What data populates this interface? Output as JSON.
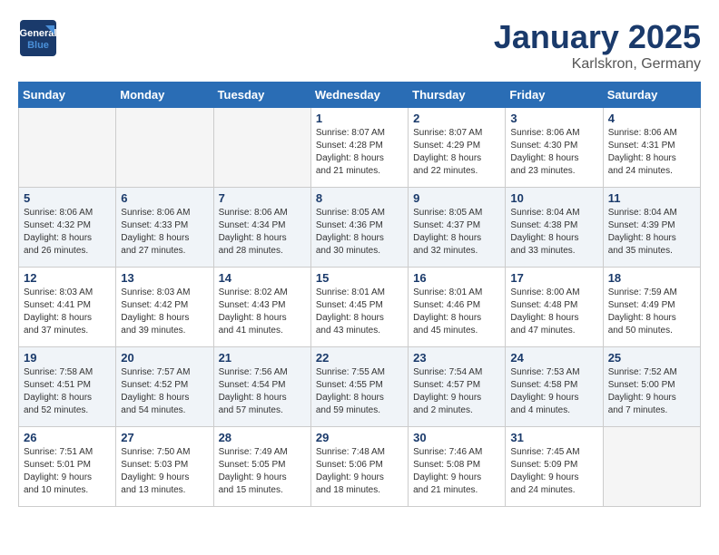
{
  "header": {
    "logo_general": "General",
    "logo_blue": "Blue",
    "title": "January 2025",
    "subtitle": "Karlskron, Germany"
  },
  "days_of_week": [
    "Sunday",
    "Monday",
    "Tuesday",
    "Wednesday",
    "Thursday",
    "Friday",
    "Saturday"
  ],
  "weeks": [
    {
      "days": [
        {
          "number": "",
          "info": "",
          "empty": true
        },
        {
          "number": "",
          "info": "",
          "empty": true
        },
        {
          "number": "",
          "info": "",
          "empty": true
        },
        {
          "number": "1",
          "info": "Sunrise: 8:07 AM\nSunset: 4:28 PM\nDaylight: 8 hours\nand 21 minutes.",
          "empty": false
        },
        {
          "number": "2",
          "info": "Sunrise: 8:07 AM\nSunset: 4:29 PM\nDaylight: 8 hours\nand 22 minutes.",
          "empty": false
        },
        {
          "number": "3",
          "info": "Sunrise: 8:06 AM\nSunset: 4:30 PM\nDaylight: 8 hours\nand 23 minutes.",
          "empty": false
        },
        {
          "number": "4",
          "info": "Sunrise: 8:06 AM\nSunset: 4:31 PM\nDaylight: 8 hours\nand 24 minutes.",
          "empty": false
        }
      ]
    },
    {
      "days": [
        {
          "number": "5",
          "info": "Sunrise: 8:06 AM\nSunset: 4:32 PM\nDaylight: 8 hours\nand 26 minutes.",
          "empty": false
        },
        {
          "number": "6",
          "info": "Sunrise: 8:06 AM\nSunset: 4:33 PM\nDaylight: 8 hours\nand 27 minutes.",
          "empty": false
        },
        {
          "number": "7",
          "info": "Sunrise: 8:06 AM\nSunset: 4:34 PM\nDaylight: 8 hours\nand 28 minutes.",
          "empty": false
        },
        {
          "number": "8",
          "info": "Sunrise: 8:05 AM\nSunset: 4:36 PM\nDaylight: 8 hours\nand 30 minutes.",
          "empty": false
        },
        {
          "number": "9",
          "info": "Sunrise: 8:05 AM\nSunset: 4:37 PM\nDaylight: 8 hours\nand 32 minutes.",
          "empty": false
        },
        {
          "number": "10",
          "info": "Sunrise: 8:04 AM\nSunset: 4:38 PM\nDaylight: 8 hours\nand 33 minutes.",
          "empty": false
        },
        {
          "number": "11",
          "info": "Sunrise: 8:04 AM\nSunset: 4:39 PM\nDaylight: 8 hours\nand 35 minutes.",
          "empty": false
        }
      ]
    },
    {
      "days": [
        {
          "number": "12",
          "info": "Sunrise: 8:03 AM\nSunset: 4:41 PM\nDaylight: 8 hours\nand 37 minutes.",
          "empty": false
        },
        {
          "number": "13",
          "info": "Sunrise: 8:03 AM\nSunset: 4:42 PM\nDaylight: 8 hours\nand 39 minutes.",
          "empty": false
        },
        {
          "number": "14",
          "info": "Sunrise: 8:02 AM\nSunset: 4:43 PM\nDaylight: 8 hours\nand 41 minutes.",
          "empty": false
        },
        {
          "number": "15",
          "info": "Sunrise: 8:01 AM\nSunset: 4:45 PM\nDaylight: 8 hours\nand 43 minutes.",
          "empty": false
        },
        {
          "number": "16",
          "info": "Sunrise: 8:01 AM\nSunset: 4:46 PM\nDaylight: 8 hours\nand 45 minutes.",
          "empty": false
        },
        {
          "number": "17",
          "info": "Sunrise: 8:00 AM\nSunset: 4:48 PM\nDaylight: 8 hours\nand 47 minutes.",
          "empty": false
        },
        {
          "number": "18",
          "info": "Sunrise: 7:59 AM\nSunset: 4:49 PM\nDaylight: 8 hours\nand 50 minutes.",
          "empty": false
        }
      ]
    },
    {
      "days": [
        {
          "number": "19",
          "info": "Sunrise: 7:58 AM\nSunset: 4:51 PM\nDaylight: 8 hours\nand 52 minutes.",
          "empty": false
        },
        {
          "number": "20",
          "info": "Sunrise: 7:57 AM\nSunset: 4:52 PM\nDaylight: 8 hours\nand 54 minutes.",
          "empty": false
        },
        {
          "number": "21",
          "info": "Sunrise: 7:56 AM\nSunset: 4:54 PM\nDaylight: 8 hours\nand 57 minutes.",
          "empty": false
        },
        {
          "number": "22",
          "info": "Sunrise: 7:55 AM\nSunset: 4:55 PM\nDaylight: 8 hours\nand 59 minutes.",
          "empty": false
        },
        {
          "number": "23",
          "info": "Sunrise: 7:54 AM\nSunset: 4:57 PM\nDaylight: 9 hours\nand 2 minutes.",
          "empty": false
        },
        {
          "number": "24",
          "info": "Sunrise: 7:53 AM\nSunset: 4:58 PM\nDaylight: 9 hours\nand 4 minutes.",
          "empty": false
        },
        {
          "number": "25",
          "info": "Sunrise: 7:52 AM\nSunset: 5:00 PM\nDaylight: 9 hours\nand 7 minutes.",
          "empty": false
        }
      ]
    },
    {
      "days": [
        {
          "number": "26",
          "info": "Sunrise: 7:51 AM\nSunset: 5:01 PM\nDaylight: 9 hours\nand 10 minutes.",
          "empty": false
        },
        {
          "number": "27",
          "info": "Sunrise: 7:50 AM\nSunset: 5:03 PM\nDaylight: 9 hours\nand 13 minutes.",
          "empty": false
        },
        {
          "number": "28",
          "info": "Sunrise: 7:49 AM\nSunset: 5:05 PM\nDaylight: 9 hours\nand 15 minutes.",
          "empty": false
        },
        {
          "number": "29",
          "info": "Sunrise: 7:48 AM\nSunset: 5:06 PM\nDaylight: 9 hours\nand 18 minutes.",
          "empty": false
        },
        {
          "number": "30",
          "info": "Sunrise: 7:46 AM\nSunset: 5:08 PM\nDaylight: 9 hours\nand 21 minutes.",
          "empty": false
        },
        {
          "number": "31",
          "info": "Sunrise: 7:45 AM\nSunset: 5:09 PM\nDaylight: 9 hours\nand 24 minutes.",
          "empty": false
        },
        {
          "number": "",
          "info": "",
          "empty": true
        }
      ]
    }
  ]
}
